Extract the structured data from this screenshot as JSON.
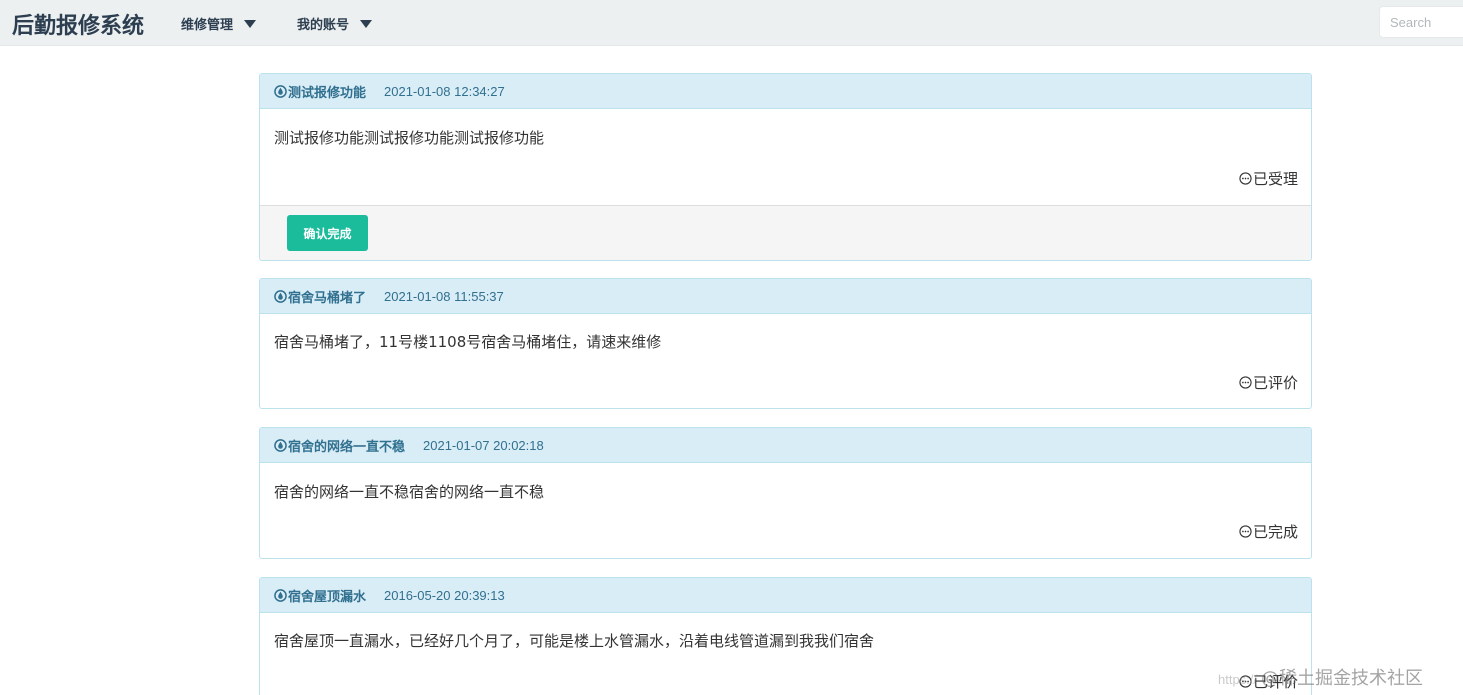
{
  "navbar": {
    "brand": "后勤报修系统",
    "menus": [
      "维修管理",
      "我的账号"
    ],
    "search_placeholder": "Search"
  },
  "repairs": [
    {
      "title": "测试报修功能",
      "time": "2021-01-08 12:34:27",
      "content": "测试报修功能测试报修功能测试报修功能",
      "status": "已受理",
      "action": "确认完成"
    },
    {
      "title": "宿舍马桶堵了",
      "time": "2021-01-08 11:55:37",
      "content": "宿舍马桶堵了，11号楼1108号宿舍马桶堵住，请速来维修",
      "status": "已评价"
    },
    {
      "title": "宿舍的网络一直不稳",
      "time": "2021-01-07 20:02:18",
      "content": "宿舍的网络一直不稳宿舍的网络一直不稳",
      "status": "已完成"
    },
    {
      "title": "宿舍屋顶漏水",
      "time": "2016-05-20 20:39:13",
      "content": "宿舍屋顶一直漏水，已经好几个月了，可能是楼上水管漏水，沿着电线管道漏到我我们宿舍",
      "status": "已评价"
    }
  ],
  "watermark": {
    "url_fragment": "https://",
    "text": "@稀土掘金技术社区"
  },
  "colors": {
    "navbar_bg": "#ecf0f1",
    "brand": "#2c3e50",
    "panel_head_bg": "#d9edf7",
    "panel_head_text": "#31708f",
    "button": "#1abc9c"
  }
}
